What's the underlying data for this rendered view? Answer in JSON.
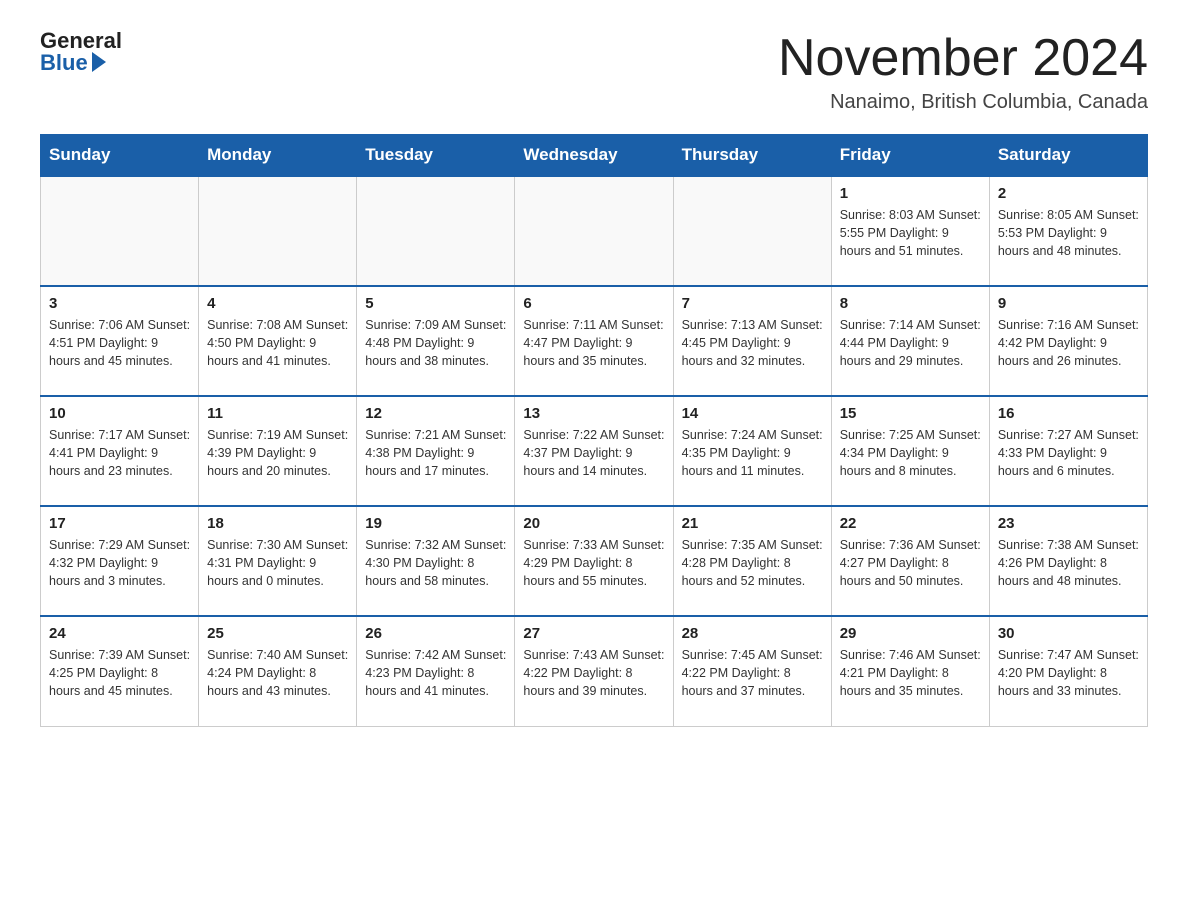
{
  "header": {
    "logo_general": "General",
    "logo_blue": "Blue",
    "month_title": "November 2024",
    "location": "Nanaimo, British Columbia, Canada"
  },
  "days_of_week": [
    "Sunday",
    "Monday",
    "Tuesday",
    "Wednesday",
    "Thursday",
    "Friday",
    "Saturday"
  ],
  "weeks": [
    [
      {
        "day": "",
        "info": ""
      },
      {
        "day": "",
        "info": ""
      },
      {
        "day": "",
        "info": ""
      },
      {
        "day": "",
        "info": ""
      },
      {
        "day": "",
        "info": ""
      },
      {
        "day": "1",
        "info": "Sunrise: 8:03 AM\nSunset: 5:55 PM\nDaylight: 9 hours and 51 minutes."
      },
      {
        "day": "2",
        "info": "Sunrise: 8:05 AM\nSunset: 5:53 PM\nDaylight: 9 hours and 48 minutes."
      }
    ],
    [
      {
        "day": "3",
        "info": "Sunrise: 7:06 AM\nSunset: 4:51 PM\nDaylight: 9 hours and 45 minutes."
      },
      {
        "day": "4",
        "info": "Sunrise: 7:08 AM\nSunset: 4:50 PM\nDaylight: 9 hours and 41 minutes."
      },
      {
        "day": "5",
        "info": "Sunrise: 7:09 AM\nSunset: 4:48 PM\nDaylight: 9 hours and 38 minutes."
      },
      {
        "day": "6",
        "info": "Sunrise: 7:11 AM\nSunset: 4:47 PM\nDaylight: 9 hours and 35 minutes."
      },
      {
        "day": "7",
        "info": "Sunrise: 7:13 AM\nSunset: 4:45 PM\nDaylight: 9 hours and 32 minutes."
      },
      {
        "day": "8",
        "info": "Sunrise: 7:14 AM\nSunset: 4:44 PM\nDaylight: 9 hours and 29 minutes."
      },
      {
        "day": "9",
        "info": "Sunrise: 7:16 AM\nSunset: 4:42 PM\nDaylight: 9 hours and 26 minutes."
      }
    ],
    [
      {
        "day": "10",
        "info": "Sunrise: 7:17 AM\nSunset: 4:41 PM\nDaylight: 9 hours and 23 minutes."
      },
      {
        "day": "11",
        "info": "Sunrise: 7:19 AM\nSunset: 4:39 PM\nDaylight: 9 hours and 20 minutes."
      },
      {
        "day": "12",
        "info": "Sunrise: 7:21 AM\nSunset: 4:38 PM\nDaylight: 9 hours and 17 minutes."
      },
      {
        "day": "13",
        "info": "Sunrise: 7:22 AM\nSunset: 4:37 PM\nDaylight: 9 hours and 14 minutes."
      },
      {
        "day": "14",
        "info": "Sunrise: 7:24 AM\nSunset: 4:35 PM\nDaylight: 9 hours and 11 minutes."
      },
      {
        "day": "15",
        "info": "Sunrise: 7:25 AM\nSunset: 4:34 PM\nDaylight: 9 hours and 8 minutes."
      },
      {
        "day": "16",
        "info": "Sunrise: 7:27 AM\nSunset: 4:33 PM\nDaylight: 9 hours and 6 minutes."
      }
    ],
    [
      {
        "day": "17",
        "info": "Sunrise: 7:29 AM\nSunset: 4:32 PM\nDaylight: 9 hours and 3 minutes."
      },
      {
        "day": "18",
        "info": "Sunrise: 7:30 AM\nSunset: 4:31 PM\nDaylight: 9 hours and 0 minutes."
      },
      {
        "day": "19",
        "info": "Sunrise: 7:32 AM\nSunset: 4:30 PM\nDaylight: 8 hours and 58 minutes."
      },
      {
        "day": "20",
        "info": "Sunrise: 7:33 AM\nSunset: 4:29 PM\nDaylight: 8 hours and 55 minutes."
      },
      {
        "day": "21",
        "info": "Sunrise: 7:35 AM\nSunset: 4:28 PM\nDaylight: 8 hours and 52 minutes."
      },
      {
        "day": "22",
        "info": "Sunrise: 7:36 AM\nSunset: 4:27 PM\nDaylight: 8 hours and 50 minutes."
      },
      {
        "day": "23",
        "info": "Sunrise: 7:38 AM\nSunset: 4:26 PM\nDaylight: 8 hours and 48 minutes."
      }
    ],
    [
      {
        "day": "24",
        "info": "Sunrise: 7:39 AM\nSunset: 4:25 PM\nDaylight: 8 hours and 45 minutes."
      },
      {
        "day": "25",
        "info": "Sunrise: 7:40 AM\nSunset: 4:24 PM\nDaylight: 8 hours and 43 minutes."
      },
      {
        "day": "26",
        "info": "Sunrise: 7:42 AM\nSunset: 4:23 PM\nDaylight: 8 hours and 41 minutes."
      },
      {
        "day": "27",
        "info": "Sunrise: 7:43 AM\nSunset: 4:22 PM\nDaylight: 8 hours and 39 minutes."
      },
      {
        "day": "28",
        "info": "Sunrise: 7:45 AM\nSunset: 4:22 PM\nDaylight: 8 hours and 37 minutes."
      },
      {
        "day": "29",
        "info": "Sunrise: 7:46 AM\nSunset: 4:21 PM\nDaylight: 8 hours and 35 minutes."
      },
      {
        "day": "30",
        "info": "Sunrise: 7:47 AM\nSunset: 4:20 PM\nDaylight: 8 hours and 33 minutes."
      }
    ]
  ]
}
